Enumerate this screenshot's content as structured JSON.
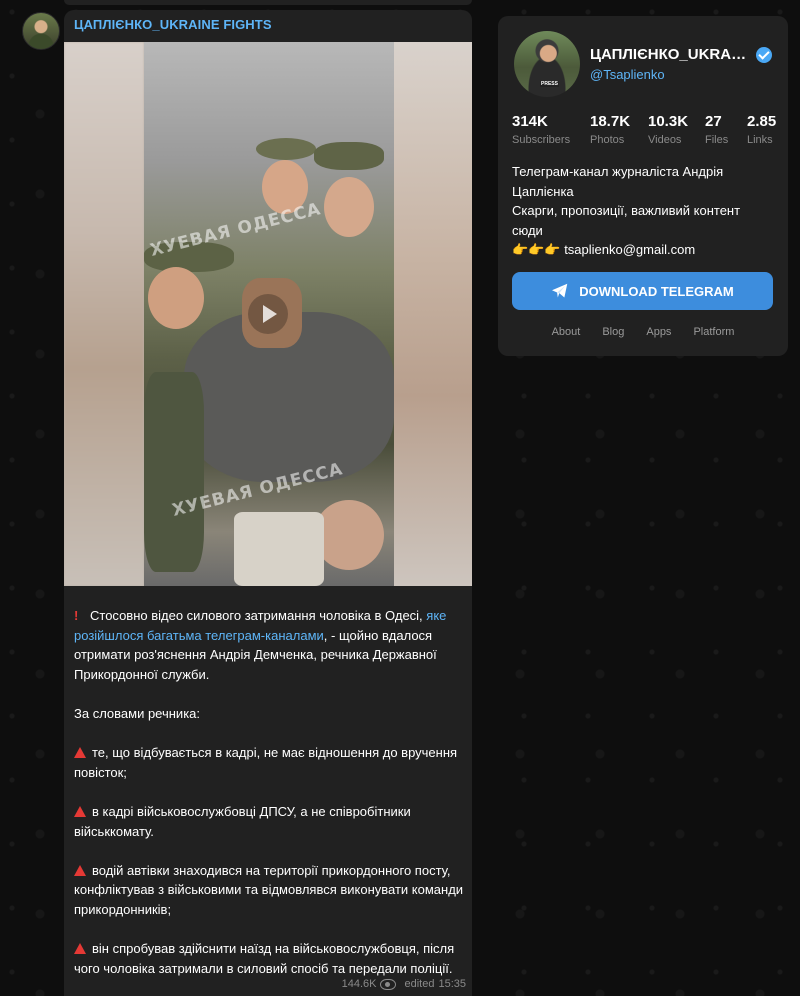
{
  "post": {
    "author": "ЦАПЛІЄНКО_UKRAINE FIGHTS",
    "watermark_top": "ХУЕВАЯ ОДЕССА",
    "watermark_bottom": "ХУЕВАЯ ОДЕССА",
    "paragraph1_before_link": "Стосовно відео силового затримання чоловіка в Одесі, ",
    "paragraph1_link": "яке розійшлося багатьма телеграм-каналами",
    "paragraph1_after_link": ", - щойно вдалося отримати роз'яснення Андрія Демченка, речника Державної Прикордонної служби.",
    "intro": "За словами речника:",
    "bullets": [
      "те, що відбувається в кадрі, не має відношення до вручення повісток;",
      "в кадрі військовослужбовці ДПСУ, а не співробітники військкомату.",
      "водій автівки знаходився на території прикордонного посту, конфліктував з військовими та відмовлявся виконувати команди прикордонників;",
      "він спробував здійснити наїзд на військовослужбовця, після чого чоловіка затримали в силовий спосіб та передали поліції."
    ],
    "views": "144.6K",
    "edited": "edited",
    "time": "15:35",
    "icons": {
      "alert": "exclamation-icon",
      "bullet": "red-triangle-icon",
      "views": "eye-icon"
    }
  },
  "channel": {
    "name": "ЦАПЛІЄНКО_UKRAIN...",
    "handle": "@Tsaplienko",
    "badge": "PRESS",
    "verified_icon": "verified-check-icon",
    "stats": [
      {
        "value": "314K",
        "label": "Subscribers"
      },
      {
        "value": "18.7K",
        "label": "Photos"
      },
      {
        "value": "10.3K",
        "label": "Videos"
      },
      {
        "value": "27",
        "label": "Files"
      },
      {
        "value": "2.85",
        "label": "Links"
      }
    ],
    "description_line1": "Телеграм-канал журналіста Андрія Цаплієнка",
    "description_line2": "Скарги, пропозиції, важливий контент сюди",
    "description_emoji": "👉👉👉",
    "description_email": "tsaplienko@gmail.com",
    "download_label": "DOWNLOAD TELEGRAM",
    "download_icon": "paper-plane-icon",
    "footer_links": [
      "About",
      "Blog",
      "Apps",
      "Platform"
    ]
  },
  "colors": {
    "accent": "#5eb5f7",
    "button": "#3d8ddd",
    "card": "#212121",
    "alert": "#e53935"
  }
}
